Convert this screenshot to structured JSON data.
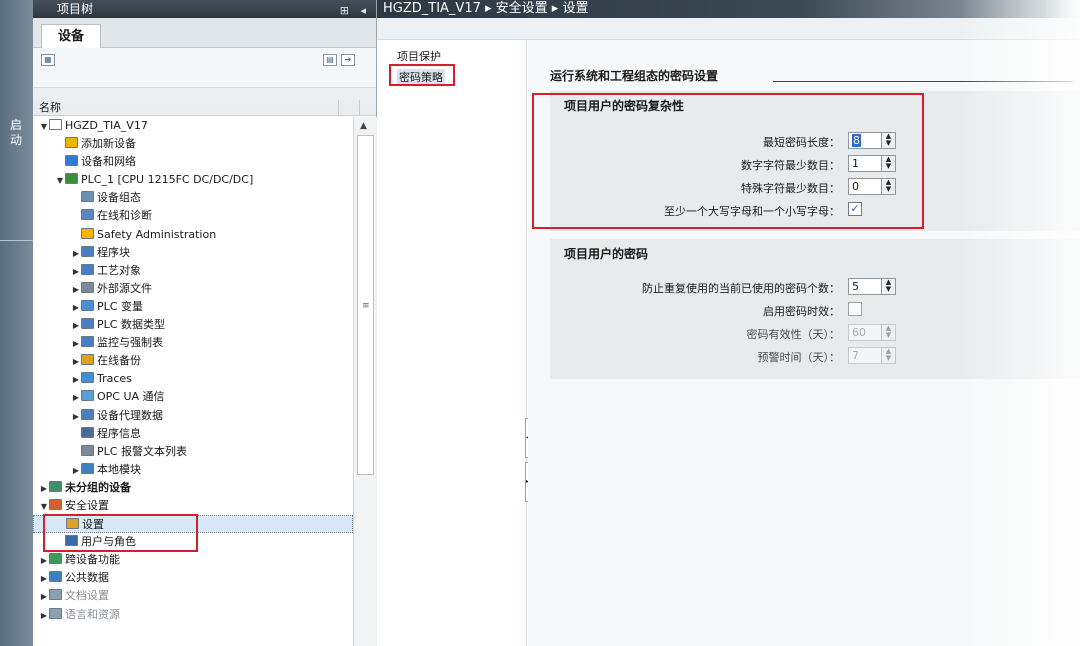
{
  "side_strip": {
    "label": "启动"
  },
  "project_tree": {
    "header_title": "项目树",
    "header_icons": "⊞ ◂",
    "tab_label": "设备",
    "column_header": "名称",
    "items": [
      {
        "label": "HGZD_TIA_V17",
        "arrow": "▼",
        "indent": 0,
        "icon_color": "#ffffff"
      },
      {
        "label": "添加新设备",
        "arrow": "",
        "indent": 1,
        "icon_color": "#f0b400"
      },
      {
        "label": "设备和网络",
        "arrow": "",
        "indent": 1,
        "icon_color": "#2f7bd0"
      },
      {
        "label": "PLC_1 [CPU 1215FC DC/DC/DC]",
        "arrow": "▼",
        "indent": 1,
        "icon_color": "#3a8f3a"
      },
      {
        "label": "设备组态",
        "arrow": "",
        "indent": 2,
        "icon_color": "#6a8fb5"
      },
      {
        "label": "在线和诊断",
        "arrow": "",
        "indent": 2,
        "icon_color": "#5a86c4"
      },
      {
        "label": "Safety Administration",
        "arrow": "",
        "indent": 2,
        "icon_color": "#f4b400"
      },
      {
        "label": "程序块",
        "arrow": "▶",
        "indent": 2,
        "icon_color": "#4a7ec2"
      },
      {
        "label": "工艺对象",
        "arrow": "▶",
        "indent": 2,
        "icon_color": "#4a7ec2"
      },
      {
        "label": "外部源文件",
        "arrow": "▶",
        "indent": 2,
        "icon_color": "#7a8a98"
      },
      {
        "label": "PLC 变量",
        "arrow": "▶",
        "indent": 2,
        "icon_color": "#4a90d9"
      },
      {
        "label": "PLC 数据类型",
        "arrow": "▶",
        "indent": 2,
        "icon_color": "#4a7ec2"
      },
      {
        "label": "监控与强制表",
        "arrow": "▶",
        "indent": 2,
        "icon_color": "#4a7ec2"
      },
      {
        "label": "在线备份",
        "arrow": "▶",
        "indent": 2,
        "icon_color": "#e0a020"
      },
      {
        "label": "Traces",
        "arrow": "▶",
        "indent": 2,
        "icon_color": "#3f8fd0"
      },
      {
        "label": "OPC UA 通信",
        "arrow": "▶",
        "indent": 2,
        "icon_color": "#5aa0d8"
      },
      {
        "label": "设备代理数据",
        "arrow": "▶",
        "indent": 2,
        "icon_color": "#4a7ec2"
      },
      {
        "label": "程序信息",
        "arrow": "",
        "indent": 2,
        "icon_color": "#4a6a9a"
      },
      {
        "label": "PLC 报警文本列表",
        "arrow": "",
        "indent": 2,
        "icon_color": "#7a8a98"
      },
      {
        "label": "本地模块",
        "arrow": "▶",
        "indent": 2,
        "icon_color": "#3f7fc0"
      },
      {
        "label": "未分组的设备",
        "arrow": "▶",
        "indent": 0,
        "icon_color": "#3a8f6a",
        "bold": true
      },
      {
        "label": "安全设置",
        "arrow": "▼",
        "indent": 0,
        "icon_color": "#d06030"
      },
      {
        "label": "设置",
        "arrow": "",
        "indent": 1,
        "icon_color": "#e0a020",
        "selected": true
      },
      {
        "label": "用户与角色",
        "arrow": "",
        "indent": 1,
        "icon_color": "#3a6aa8"
      },
      {
        "label": "跨设备功能",
        "arrow": "▶",
        "indent": 0,
        "icon_color": "#3a9a5a"
      },
      {
        "label": "公共数据",
        "arrow": "▶",
        "indent": 0,
        "icon_color": "#3f7fc0"
      },
      {
        "label": "文档设置",
        "arrow": "▶",
        "indent": 0,
        "icon_color": "#8aa0b0",
        "dim": true
      },
      {
        "label": "语言和资源",
        "arrow": "▶",
        "indent": 0,
        "icon_color": "#8aa0b0",
        "dim": true
      }
    ]
  },
  "main": {
    "breadcrumb": "HGZD_TIA_V17 ▸ 安全设置 ▸ 设置",
    "nav": [
      {
        "label": "项目保护"
      },
      {
        "label": "密码策略",
        "selected": true
      }
    ],
    "section_title": "运行系统和工程组态的密码设置",
    "complexity": {
      "title": "项目用户的密码复杂性",
      "min_length_label": "最短密码长度：",
      "min_length_value": "8",
      "min_digits_label": "数字字符最少数目：",
      "min_digits_value": "1",
      "min_special_label": "特殊字符最少数目：",
      "min_special_value": "0",
      "upper_lower_label": "至少一个大写字母和一个小写字母：",
      "upper_lower_checked": true
    },
    "password": {
      "title": "项目用户的密码",
      "reuse_label": "防止重复使用的当前已使用的密码个数：",
      "reuse_value": "5",
      "expire_label": "启用密码时效：",
      "expire_checked": false,
      "validity_label": "密码有效性（天）：",
      "validity_value": "60",
      "warning_label": "预警时间（天）：",
      "warning_value": "7"
    }
  },
  "colors": {
    "highlight_box": "#d81e2c",
    "header_dark": "#2c3843",
    "checkbox_check": "#2a62b9"
  }
}
